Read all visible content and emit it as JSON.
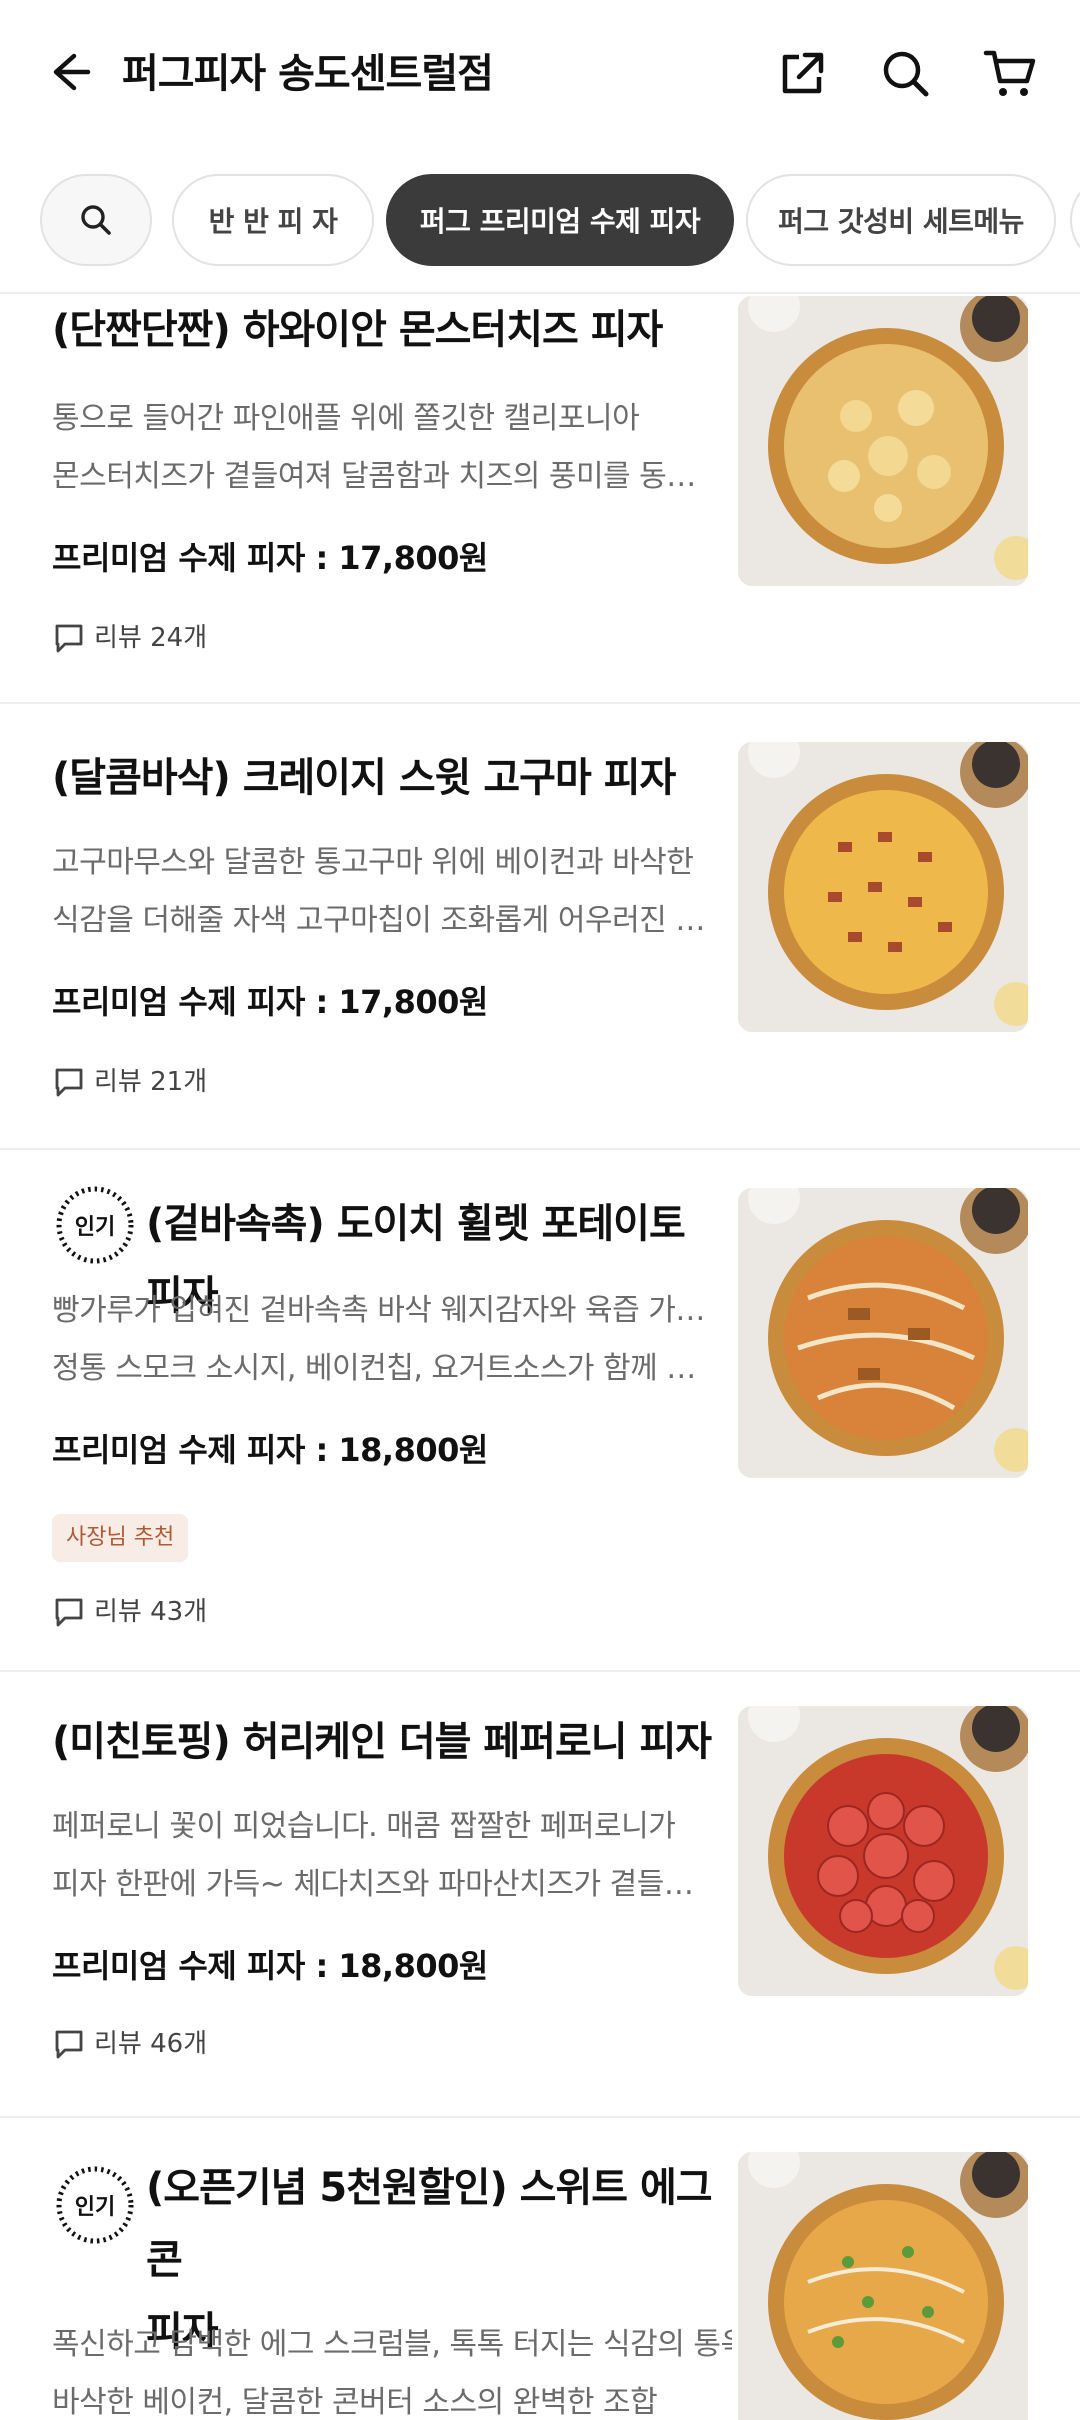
{
  "header": {
    "title": "퍼그피자 송도센트럴점",
    "back_icon": "arrow-left-icon",
    "share_icon": "share-icon",
    "search_icon": "search-icon",
    "cart_icon": "cart-icon"
  },
  "categories": {
    "search_icon": "search-icon",
    "items": [
      "반 반 피 자",
      "퍼그 프리미엄 수제 피자",
      "퍼그 갓성비 세트메뉴"
    ],
    "selected": "퍼그 프리미엄 수제 피자"
  },
  "menu": [
    {
      "name": "(단짠단짠) 하와이안 몬스터치즈 피자",
      "desc1": "통으로 들어간 파인애플 위에 쫄깃한 캘리포니아",
      "desc2": "몬스터치즈가 곁들여져 달콤함과 치즈의 풍미를 동시에 느…",
      "price": "프리미엄 수제 피자 : 17,800원",
      "review": "리뷰 24개",
      "popular": false
    },
    {
      "name": "(달콤바삭) 크레이지 스윗 고구마 피자",
      "desc1": "고구마무스와 달콤한 통고구마 위에 베이컨과 바삭한",
      "desc2": "식감을 더해줄 자색 고구마칩이 조화롭게 어우러진 크레…",
      "price": "프리미엄 수제 피자 : 17,800원",
      "review": "리뷰 21개",
      "popular": false
    },
    {
      "name": "(겉바속촉) 도이치 휠렛 포테이토피자",
      "badge": "인기",
      "desc1": "빵가루가 입혀진 겉바속촉 바삭 웨지감자와 육즙 가득한",
      "desc2": "정통 스모크 소시지, 베이컨칩, 요거트소스가 함께 어우러…",
      "price": "프리미엄 수제 피자 : 18,800원",
      "tag": "사장님 추천",
      "review": "리뷰 43개",
      "popular": true
    },
    {
      "name": "(미친토핑) 허리케인 더블 페퍼로니 피자",
      "desc1": "페퍼로니 꽃이 피었습니다. 매콤 짭짤한 페퍼로니가",
      "desc2": "피자 한판에 가득~ 체다치즈와 파마산치즈가 곁들여…",
      "price": "프리미엄 수제 피자 : 18,800원",
      "review": "리뷰 46개",
      "popular": false
    },
    {
      "name": "(오픈기념 5천원할인) 스위트 에그콘",
      "name2": "피자",
      "badge": "인기",
      "desc1": "폭신하고 담백한 에그 스크럼블, 톡톡 터지는 식감의 통옥수수,",
      "desc2": "바삭한 베이컨, 달콤한 콘버터 소스의 완벽한 조합",
      "popular": true
    }
  ],
  "colors": {
    "selected_chip": "#3b3b3b",
    "tag_bg": "#f7ece6",
    "tag_text": "#b05a34",
    "desc_text": "#6b6b6b"
  }
}
